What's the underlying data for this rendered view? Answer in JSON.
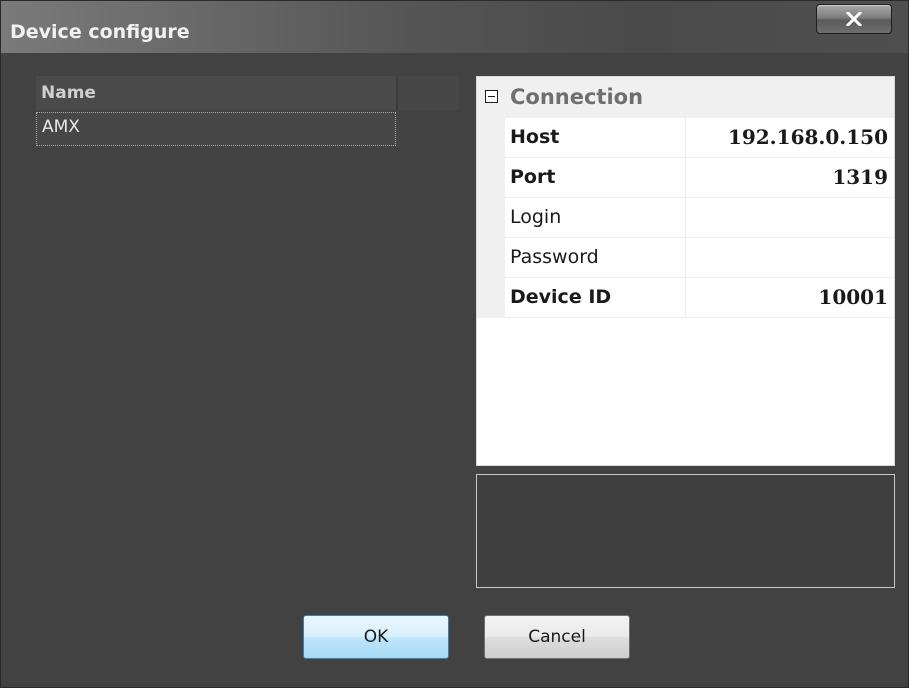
{
  "window": {
    "title": "Device configure",
    "close_icon": "close-x-icon"
  },
  "device_list": {
    "column_header": "Name",
    "rows": [
      {
        "name": "AMX"
      }
    ]
  },
  "property_grid": {
    "category": {
      "label": "Connection",
      "expander_icon": "collapse-minus-icon",
      "expanded": true
    },
    "properties": [
      {
        "name": "Host",
        "value": "192.168.0.150",
        "bold": true
      },
      {
        "name": "Port",
        "value": "1319",
        "bold": true
      },
      {
        "name": "Login",
        "value": "",
        "bold": false
      },
      {
        "name": "Password",
        "value": "",
        "bold": false
      },
      {
        "name": "Device ID",
        "value": "10001",
        "bold": true
      }
    ],
    "description": ""
  },
  "buttons": {
    "ok_label": "OK",
    "cancel_label": "Cancel"
  },
  "colors": {
    "window_bg": "#424242",
    "ok_accent": "#3c7fb1"
  }
}
